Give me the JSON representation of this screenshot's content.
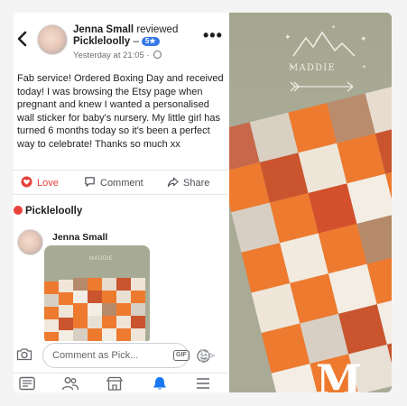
{
  "review": {
    "reviewer_name": "Jenna Small",
    "action": "reviewed",
    "page_name": "Pickleloolly",
    "rating_badge": "5★",
    "timestamp": "Yesterday at 21:05",
    "body": "Fab service! Ordered Boxing Day and received today! I was browsing the Etsy page when pregnant and knew I wanted a personalised wall sticker for baby's nursery. My little girl has turned 6 months today so it's been a perfect way to celebrate! Thanks so much xx"
  },
  "actions": {
    "love_label": "Love",
    "comment_label": "Comment",
    "share_label": "Share"
  },
  "reaction": {
    "page_name": "Pickleloolly"
  },
  "reply": {
    "author": "Jenna Small"
  },
  "comment_box": {
    "placeholder": "Comment as Pick...",
    "gif_label": "GIF"
  },
  "photo": {
    "sticker_text": "MADDIE",
    "monogram": "M"
  },
  "colors": {
    "love_red": "#e8413c",
    "accent_blue": "#3578e5",
    "active_tab": "#1877f2"
  },
  "icons": [
    "back-chevron-icon",
    "more-options-icon",
    "globe-icon",
    "love-icon",
    "comment-icon",
    "share-icon",
    "heart-icon",
    "camera-icon",
    "emoji-icon",
    "send-icon",
    "news-feed-icon",
    "groups-icon",
    "marketplace-icon",
    "notifications-icon",
    "menu-icon"
  ]
}
